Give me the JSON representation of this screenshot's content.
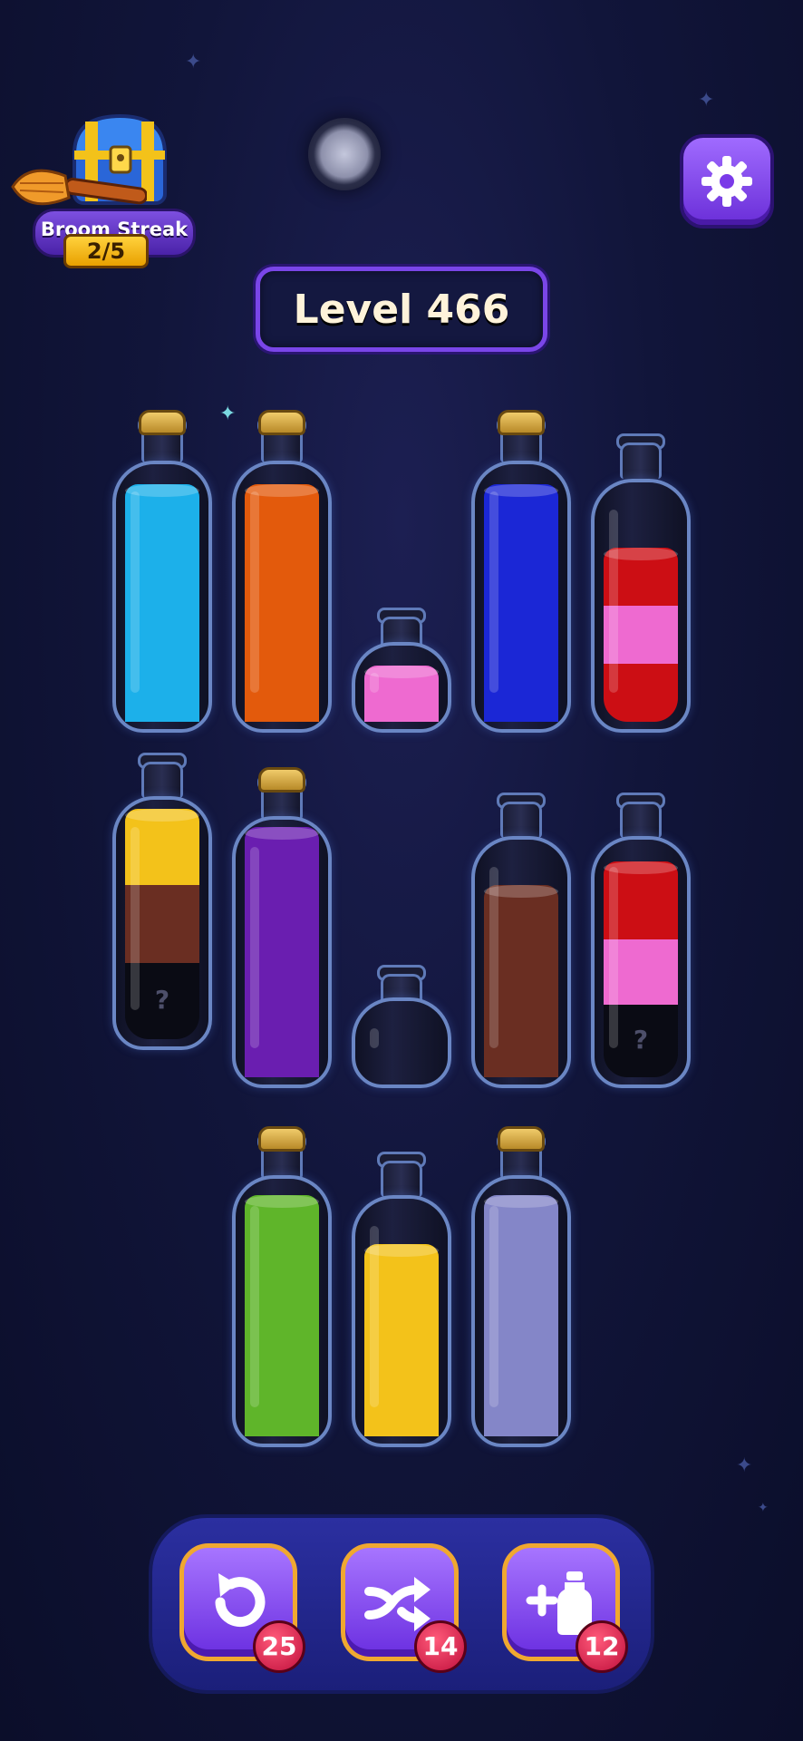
{
  "streak": {
    "label": "Broom Streak",
    "count": "2/5"
  },
  "level": {
    "title": "Level 466"
  },
  "bottles": [
    {
      "id": 1,
      "corked": true,
      "layers": [
        "light-blue"
      ]
    },
    {
      "id": 2,
      "corked": true,
      "layers": [
        "orange"
      ]
    },
    {
      "id": 3,
      "corked": false,
      "layers": [
        "pink"
      ]
    },
    {
      "id": 4,
      "corked": true,
      "layers": [
        "blue"
      ]
    },
    {
      "id": 5,
      "corked": false,
      "layers": [
        "red",
        "pink",
        "red"
      ]
    },
    {
      "id": 6,
      "corked": false,
      "layers": [
        "yellow",
        "brown",
        "hidden"
      ]
    },
    {
      "id": 7,
      "corked": true,
      "layers": [
        "purple"
      ]
    },
    {
      "id": 8,
      "corked": false,
      "layers": []
    },
    {
      "id": 9,
      "corked": false,
      "layers": [
        "brown"
      ]
    },
    {
      "id": 10,
      "corked": false,
      "layers": [
        "red",
        "pink",
        "hidden"
      ]
    },
    {
      "id": 11,
      "corked": true,
      "layers": [
        "green"
      ]
    },
    {
      "id": 12,
      "corked": false,
      "layers": [
        "yellow"
      ]
    },
    {
      "id": 13,
      "corked": true,
      "layers": [
        "lavender"
      ]
    }
  ],
  "hidden_marker": "?",
  "tools": {
    "undo": {
      "count": "25",
      "icon": "undo-icon"
    },
    "shuffle": {
      "count": "14",
      "icon": "shuffle-icon"
    },
    "add_bottle": {
      "count": "12",
      "icon": "add-bottle-icon"
    }
  },
  "colors": {
    "light-blue": "#1cb0ea",
    "orange": "#e35a0c",
    "pink": "#ee6ad0",
    "blue": "#1b27d6",
    "red": "#cc0e14",
    "yellow": "#f3c21a",
    "brown": "#6a2e22",
    "purple": "#6a1eb0",
    "green": "#5fb52a",
    "lavender": "#8486c8",
    "hidden": "#0a0b14"
  }
}
